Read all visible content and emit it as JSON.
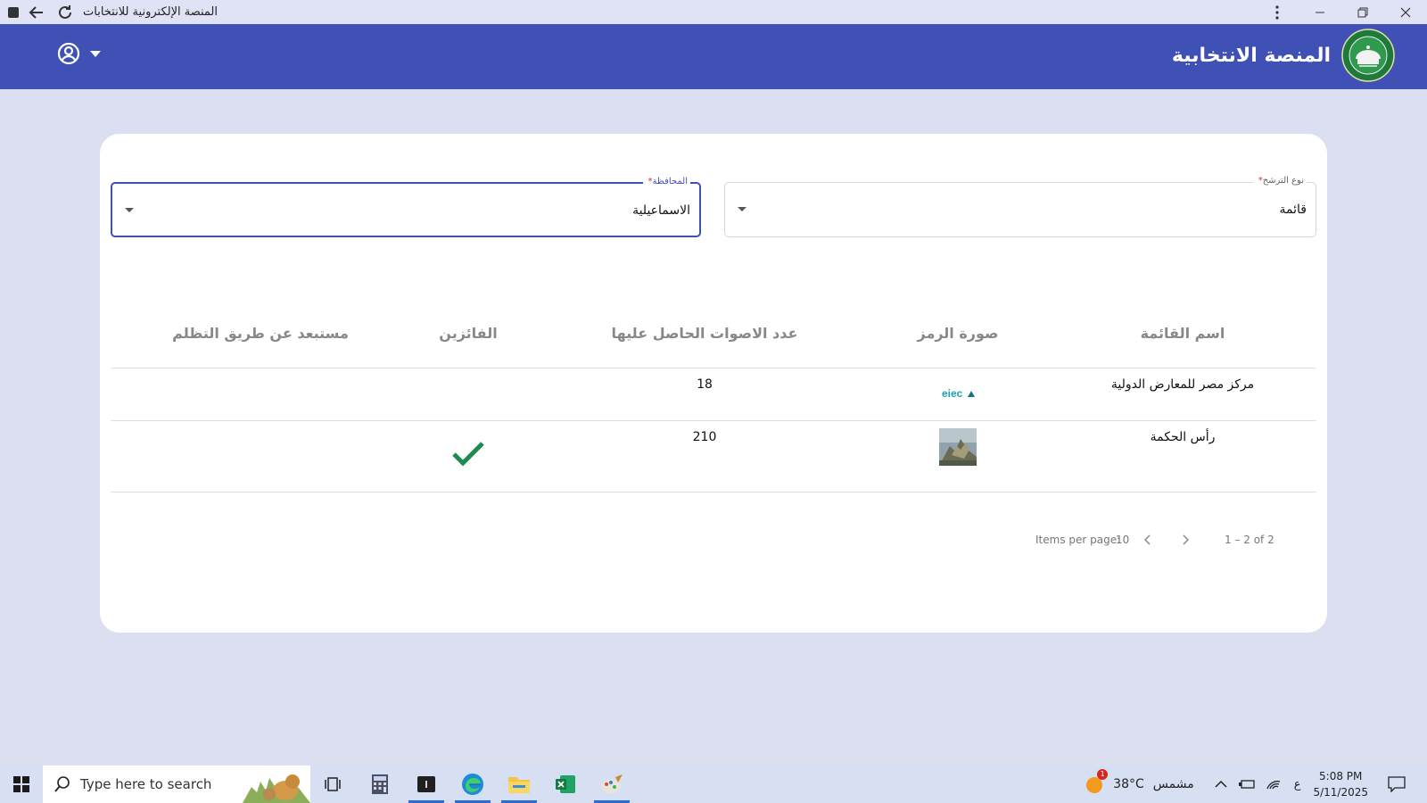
{
  "window": {
    "title": "المنصة الإلكترونية للانتخابات"
  },
  "header": {
    "brand_title": "المنصة الانتخابية"
  },
  "filters": {
    "candidacy_type": {
      "label": "نوع الترشح",
      "required_mark": "*",
      "value": "قائمة"
    },
    "governorate": {
      "label": "المحافظة",
      "required_mark": "*",
      "value": "الاسماعيلية"
    }
  },
  "table": {
    "columns": [
      "اسم القائمة",
      "صورة الرمز",
      "عدد الاصوات الحاصل عليها",
      "الفائزين",
      "مستبعد عن طريق التظلم"
    ],
    "rows": [
      {
        "list_name": "مركز مصر للمعارض الدولية",
        "symbol": "eiec",
        "votes": "18",
        "winner": false
      },
      {
        "list_name": "رأس الحكمة",
        "symbol": "mountain-photo",
        "votes": "210",
        "winner": true
      }
    ]
  },
  "paginator": {
    "items_per_page_label": "Items per page:",
    "page_size": "10",
    "range": "1 – 2 of 2"
  },
  "taskbar": {
    "search_placeholder": "Type here to search",
    "weather_temp": "38°C",
    "weather_text": "مشمس",
    "weather_badge": "1",
    "lang": "ع",
    "time": "5:08 PM",
    "date": "5/11/2025"
  },
  "colors": {
    "primary": "#3f51b5",
    "background": "#dcdff0",
    "winner_check": "#1e8a50"
  }
}
